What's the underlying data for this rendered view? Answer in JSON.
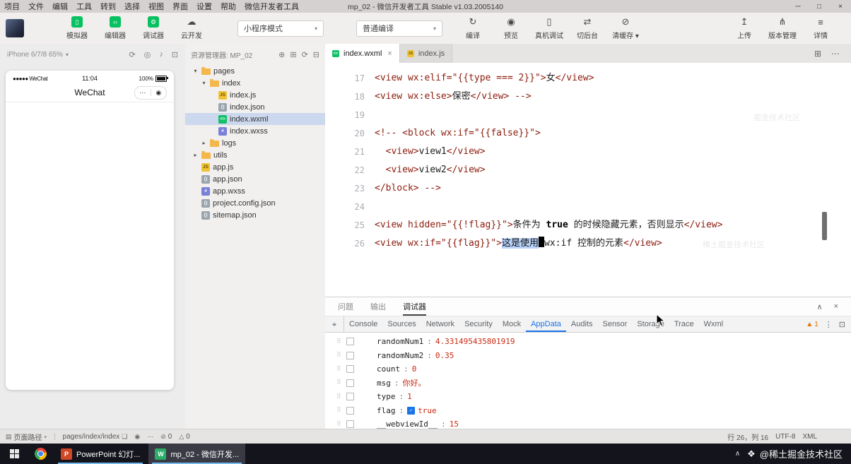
{
  "window": {
    "title": "mp_02 - 微信开发者工具 Stable v1.03.2005140",
    "controls": {
      "min": "─",
      "max": "□",
      "close": "×"
    }
  },
  "menubar": [
    "项目",
    "文件",
    "编辑",
    "工具",
    "转到",
    "选择",
    "视图",
    "界面",
    "设置",
    "帮助",
    "微信开发者工具"
  ],
  "toolbar": {
    "left_buttons": [
      {
        "name": "simulator",
        "label": "模拟器",
        "glyph": "▯",
        "style": "green"
      },
      {
        "name": "editor",
        "label": "编辑器",
        "glyph": "‹›",
        "style": "green"
      },
      {
        "name": "debugger",
        "label": "调试器",
        "glyph": "⚙",
        "style": "green"
      },
      {
        "name": "cloud-dev",
        "label": "云开发",
        "glyph": "☁",
        "style": "plain"
      }
    ],
    "mode_select": {
      "label": "小程序模式",
      "caret": "▾"
    },
    "compile_select": {
      "label": "普通编译",
      "caret": "▾"
    },
    "mid_buttons": [
      {
        "name": "compile",
        "label": "编译",
        "glyph": "↻"
      },
      {
        "name": "preview",
        "label": "预览",
        "glyph": "◉"
      },
      {
        "name": "device-debug",
        "label": "真机调试",
        "glyph": "▯"
      },
      {
        "name": "switch-background",
        "label": "切后台",
        "glyph": "⇄"
      },
      {
        "name": "clear-cache",
        "label": "清缓存 ▾",
        "glyph": "⊘"
      }
    ],
    "right_buttons": [
      {
        "name": "upload",
        "label": "上传",
        "glyph": "↥"
      },
      {
        "name": "version-manage",
        "label": "版本管理",
        "glyph": "⋔"
      },
      {
        "name": "details",
        "label": "详情",
        "glyph": "≡"
      }
    ]
  },
  "simulator": {
    "device_label": "iPhone 6/7/8 65%",
    "header_icons": [
      {
        "name": "rotate-icon",
        "glyph": "⟳"
      },
      {
        "name": "home-icon",
        "glyph": "◎"
      },
      {
        "name": "sound-icon",
        "glyph": "♪"
      },
      {
        "name": "screenshot-icon",
        "glyph": "⊡"
      }
    ],
    "status": {
      "carrier": "●●●●● WeChat",
      "time": "11:04",
      "battery": "100%"
    },
    "nav_title": "WeChat",
    "capsule": {
      "more": "⋯",
      "home": "◉"
    }
  },
  "explorer": {
    "title": "资源管理器: MP_02",
    "header_icons": [
      {
        "name": "new-file-icon",
        "glyph": "⊕"
      },
      {
        "name": "new-folder-icon",
        "glyph": "⊞"
      },
      {
        "name": "refresh-icon",
        "glyph": "⟳"
      },
      {
        "name": "collapse-all-icon",
        "glyph": "⊟"
      }
    ],
    "file_icon_glyphs": {
      "js": "JS",
      "json": "{}",
      "wxml": "<>",
      "wxss": "#"
    },
    "tree": [
      {
        "label": "pages",
        "indent": 0,
        "arrow": "open",
        "icon": "folder"
      },
      {
        "label": "index",
        "indent": 1,
        "arrow": "open",
        "icon": "folder"
      },
      {
        "label": "index.js",
        "indent": 2,
        "icon": "js"
      },
      {
        "label": "index.json",
        "indent": 2,
        "icon": "json"
      },
      {
        "label": "index.wxml",
        "indent": 2,
        "icon": "wxml",
        "selected": true
      },
      {
        "label": "index.wxss",
        "indent": 2,
        "icon": "wxss"
      },
      {
        "label": "logs",
        "indent": 1,
        "arrow": "closed",
        "icon": "folder"
      },
      {
        "label": "utils",
        "indent": 0,
        "arrow": "closed",
        "icon": "folder"
      },
      {
        "label": "app.js",
        "indent": 0,
        "icon": "js"
      },
      {
        "label": "app.json",
        "indent": 0,
        "icon": "json"
      },
      {
        "label": "app.wxss",
        "indent": 0,
        "icon": "wxss"
      },
      {
        "label": "project.config.json",
        "indent": 0,
        "icon": "json"
      },
      {
        "label": "sitemap.json",
        "indent": 0,
        "icon": "json"
      }
    ]
  },
  "editor": {
    "tabs": [
      {
        "label": "index.wxml",
        "icon": "wxml",
        "active": true,
        "close": "×"
      },
      {
        "label": "index.js",
        "icon": "js",
        "active": false
      }
    ],
    "tab_actions": [
      {
        "name": "split-editor-icon",
        "glyph": "⊞"
      },
      {
        "name": "more-actions-icon",
        "glyph": "⋯"
      }
    ],
    "lines": [
      {
        "no": "17",
        "segs": [
          {
            "c": "tag",
            "s": "<view wx:elif=\"{{type === 2}}\">"
          },
          {
            "c": "text",
            "s": "女"
          },
          {
            "c": "tag",
            "s": "</view>"
          }
        ]
      },
      {
        "no": "18",
        "segs": [
          {
            "c": "tag",
            "s": "<view wx:else>"
          },
          {
            "c": "text",
            "s": "保密"
          },
          {
            "c": "tag",
            "s": "</view>"
          },
          {
            "c": "tag",
            "s": " -->"
          }
        ]
      },
      {
        "no": "19",
        "segs": []
      },
      {
        "no": "20",
        "segs": [
          {
            "c": "tag",
            "s": "<!-- <block wx:if=\"{{false}}\">"
          }
        ]
      },
      {
        "no": "21",
        "segs": [
          {
            "c": "text",
            "s": "  "
          },
          {
            "c": "tag",
            "s": "<view>"
          },
          {
            "c": "text",
            "s": "view1"
          },
          {
            "c": "tag",
            "s": "</view>"
          }
        ]
      },
      {
        "no": "22",
        "segs": [
          {
            "c": "text",
            "s": "  "
          },
          {
            "c": "tag",
            "s": "<view>"
          },
          {
            "c": "text",
            "s": "view2"
          },
          {
            "c": "tag",
            "s": "</view>"
          }
        ]
      },
      {
        "no": "23",
        "segs": [
          {
            "c": "tag",
            "s": "</block> -->"
          }
        ]
      },
      {
        "no": "24",
        "segs": []
      },
      {
        "no": "25",
        "segs": [
          {
            "c": "tag",
            "s": "<view hidden=\"{{!flag}}\">"
          },
          {
            "c": "text",
            "s": "条件为 "
          },
          {
            "c": "kw",
            "s": "true"
          },
          {
            "c": "text",
            "s": " 的时候隐藏元素，否则显示"
          },
          {
            "c": "tag",
            "s": "</view>"
          }
        ]
      },
      {
        "no": "26",
        "segs": [
          {
            "c": "tag",
            "s": "<view wx:if=\"{{flag}}\">"
          },
          {
            "c": "sel",
            "s": "这是使用"
          },
          {
            "c": "cursor",
            "s": ""
          },
          {
            "c": "text",
            "s": "wx:if 控制的元素"
          },
          {
            "c": "tag",
            "s": "</view>"
          }
        ]
      }
    ]
  },
  "panel": {
    "tabs": [
      {
        "label": "问题"
      },
      {
        "label": "输出"
      },
      {
        "label": "调试器",
        "active": true
      }
    ],
    "actions": [
      {
        "name": "collapse-panel-icon",
        "glyph": "∧"
      },
      {
        "name": "close-panel-icon",
        "glyph": "×"
      }
    ],
    "inspect_glyph": "⌖",
    "devtools_tabs": [
      "Console",
      "Sources",
      "Network",
      "Security",
      "Mock",
      "AppData",
      "Audits",
      "Sensor",
      "Storage",
      "Trace",
      "Wxml"
    ],
    "active_devtools_tab": "AppData",
    "warning_glyph": "▲",
    "warning_count": "1",
    "right_icons": [
      {
        "name": "devtools-more-icon",
        "glyph": "⋮"
      },
      {
        "name": "devtools-dock-icon",
        "glyph": "⊡"
      }
    ],
    "gutter": {
      "drag_glyph": "⠿",
      "check_glyph": "✓"
    },
    "appdata": [
      {
        "key": "randomNum1",
        "value": "4.331495435801919"
      },
      {
        "key": "randomNum2",
        "value": "0.35"
      },
      {
        "key": "count",
        "value": "0"
      },
      {
        "key": "msg",
        "value": "你好。"
      },
      {
        "key": "type",
        "value": "1"
      },
      {
        "key": "flag",
        "value": "true",
        "checked": true
      },
      {
        "key": "__webviewId__",
        "value": "15"
      }
    ]
  },
  "statusbar": {
    "left": [
      {
        "name": "page-path-mode",
        "glyph": "▤",
        "text": "页面路径",
        "caret": "▾"
      },
      {
        "divider": true
      },
      {
        "name": "page-path",
        "text": "pages/index/index",
        "trail_glyph": "❏"
      },
      {
        "name": "preview-eye",
        "glyph": "◉"
      },
      {
        "name": "status-more",
        "glyph": "⋯"
      },
      {
        "name": "error-count",
        "glyph": "⊘",
        "text": "0"
      },
      {
        "name": "warning-count",
        "glyph": "△",
        "text": "0"
      }
    ],
    "right": [
      {
        "name": "cursor-position",
        "text": "行 26，列 16"
      },
      {
        "name": "encoding",
        "text": "UTF-8"
      },
      {
        "name": "language-mode",
        "text": "XML"
      }
    ]
  },
  "taskbar": {
    "apps": [
      {
        "name": "powerpoint",
        "label": "PowerPoint 幻灯...",
        "icon_text": "P",
        "icon_color": "#d24726"
      },
      {
        "name": "wechat-devtools",
        "label": "mp_02 - 微信开发...",
        "icon_text": "W",
        "icon_color": "#2aae67",
        "active": true
      }
    ],
    "tray_chevron": "∧",
    "watermark": {
      "logo": "❖",
      "text": "@稀土掘金技术社区"
    }
  },
  "watermarks_faint": [
    {
      "text": "掘金技术社区"
    },
    {
      "text": "稀土掘金技术社区"
    }
  ]
}
